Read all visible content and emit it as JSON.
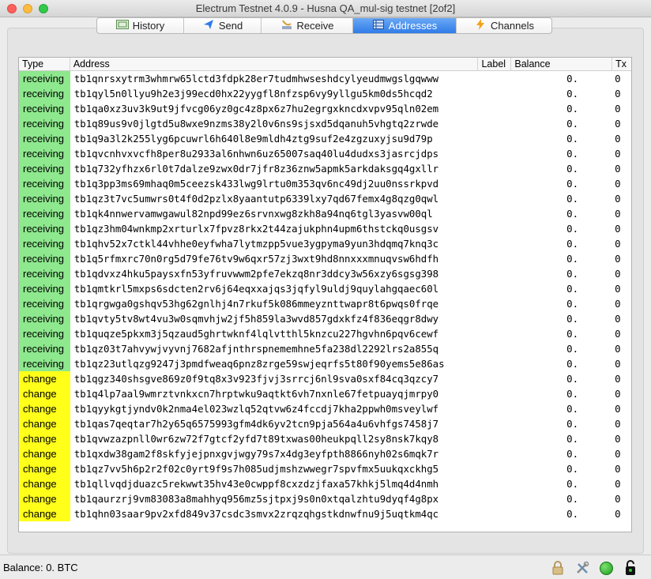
{
  "window": {
    "title": "Electrum Testnet 4.0.9  -  Husna QA_mul-sig testnet  [2of2]"
  },
  "tabs": [
    {
      "label": "History",
      "icon": "history-icon",
      "active": false
    },
    {
      "label": "Send",
      "icon": "send-icon",
      "active": false
    },
    {
      "label": "Receive",
      "icon": "receive-icon",
      "active": false
    },
    {
      "label": "Addresses",
      "icon": "addresses-icon",
      "active": true
    },
    {
      "label": "Channels",
      "icon": "lightning-icon",
      "active": false
    }
  ],
  "table": {
    "headers": {
      "type": "Type",
      "address": "Address",
      "label": "Label",
      "balance": "Balance",
      "tx": "Tx"
    },
    "rows": [
      {
        "type": "receiving",
        "address": "tb1qnrsxytrm3whmrw65lctd3fdpk28er7tudmhwseshdcylyeudmwgslgqwww",
        "label": "",
        "balance": "0.",
        "tx": "0"
      },
      {
        "type": "receiving",
        "address": "tb1qyl5n0llyu9h2e3j99ecd0hx22yygfl8nfzsp6vy9yllgu5km0ds5hcqd2",
        "label": "",
        "balance": "0.",
        "tx": "0"
      },
      {
        "type": "receiving",
        "address": "tb1qa0xz3uv3k9ut9jfvcg06yz0gc4z8px6z7hu2egrgxkncdxvpv95qln02em",
        "label": "",
        "balance": "0.",
        "tx": "0"
      },
      {
        "type": "receiving",
        "address": "tb1q89us9v0jlgtd5u8wxe9nzms38y2l0v6ns9sjsxd5dqanuh5vhgtq2zrwde",
        "label": "",
        "balance": "0.",
        "tx": "0"
      },
      {
        "type": "receiving",
        "address": "tb1q9a3l2k255lyg6pcuwrl6h640l8e9mldh4ztg9suf2e4zgzuxyjsu9d79p",
        "label": "",
        "balance": "0.",
        "tx": "0"
      },
      {
        "type": "receiving",
        "address": "tb1qvcnhvxvcfh8per8u2933al6nhwn6uz65007saq40lu4dudxs3jasrcjdps",
        "label": "",
        "balance": "0.",
        "tx": "0"
      },
      {
        "type": "receiving",
        "address": "tb1q732yfhzx6rl0t7dalze9zwx0dr7jfr8z36znw5apmk5arkdaksgq4gxllr",
        "label": "",
        "balance": "0.",
        "tx": "0"
      },
      {
        "type": "receiving",
        "address": "tb1q3pp3ms69mhaq0m5ceezsk433lwg9lrtu0m353qv6nc49dj2uu0nssrkpvd",
        "label": "",
        "balance": "0.",
        "tx": "0"
      },
      {
        "type": "receiving",
        "address": "tb1qz3t7vc5umwrs0t4f0d2pzlx8yaantutp6339lxy7qd67femx4g8qzg0qwl",
        "label": "",
        "balance": "0.",
        "tx": "0"
      },
      {
        "type": "receiving",
        "address": "tb1qk4nnwervamwgawul82npd99ez6srvnxwg8zkh8a94nq6tgl3yasvw00ql",
        "label": "",
        "balance": "0.",
        "tx": "0"
      },
      {
        "type": "receiving",
        "address": "tb1qz3hm04wnkmp2xrturlx7fpvz8rkx2t44zajukphn4upm6thstckq0usgsv",
        "label": "",
        "balance": "0.",
        "tx": "0"
      },
      {
        "type": "receiving",
        "address": "tb1qhv52x7ctkl44vhhe0eyfwha7lytmzpp5vue3ygpyma9yun3hdqmq7knq3c",
        "label": "",
        "balance": "0.",
        "tx": "0"
      },
      {
        "type": "receiving",
        "address": "tb1q5rfmxrc70n0rg5d79fe76tv9w6qxr57zj3wxt9hd8nnxxxmnuqvsw6hdfh",
        "label": "",
        "balance": "0.",
        "tx": "0"
      },
      {
        "type": "receiving",
        "address": "tb1qdvxz4hku5paysxfn53yfruvwwm2pfe7ekzq8nr3ddcy3w56xzy6sgsg398",
        "label": "",
        "balance": "0.",
        "tx": "0"
      },
      {
        "type": "receiving",
        "address": "tb1qmtkrl5mxps6sdcten2rv6j64eqxxajqs3jqfyl9uldj9quylahgqaec60l",
        "label": "",
        "balance": "0.",
        "tx": "0"
      },
      {
        "type": "receiving",
        "address": "tb1qrgwga0gshqv53hg62gnlhj4n7rkuf5k086mmeyznttwapr8t6pwqs0frqe",
        "label": "",
        "balance": "0.",
        "tx": "0"
      },
      {
        "type": "receiving",
        "address": "tb1qvty5tv8wt4vu3w0sqmvhjw2jf5h859la3wvd857gdxkfz4f836eqgr8dwy",
        "label": "",
        "balance": "0.",
        "tx": "0"
      },
      {
        "type": "receiving",
        "address": "tb1quqze5pkxm3j5qzaud5ghrtwknf4lqlvtthl5knzcu227hgvhn6pqv6cewf",
        "label": "",
        "balance": "0.",
        "tx": "0"
      },
      {
        "type": "receiving",
        "address": "tb1qz03t7ahvywjvyvnj7682afjnthrspnememhne5fa238dl2292lrs2a855q",
        "label": "",
        "balance": "0.",
        "tx": "0"
      },
      {
        "type": "receiving",
        "address": "tb1qz23utlqzg9247j3pmdfweaq6pnz8zrge59swjeqrfs5t80f90yems5e86as",
        "label": "",
        "balance": "0.",
        "tx": "0"
      },
      {
        "type": "change",
        "address": "tb1qgz340shsgve869z0f9tq8x3v923fjvj3srrcj6nl9sva0sxf84cq3qzcy7",
        "label": "",
        "balance": "0.",
        "tx": "0"
      },
      {
        "type": "change",
        "address": "tb1q4lp7aal9wmrztvnkxcn7hrptwku9aqtkt6vh7nxnle67fetpuayqjmrpy0",
        "label": "",
        "balance": "0.",
        "tx": "0"
      },
      {
        "type": "change",
        "address": "tb1qyykgtjyndv0k2nma4el023wzlq52qtvw6z4fccdj7kha2ppwh0msveylwf",
        "label": "",
        "balance": "0.",
        "tx": "0"
      },
      {
        "type": "change",
        "address": "tb1qas7qeqtar7h2y65q6575993gfm4dk6yv2tcn9pja564a4u6vhfgs7458j7",
        "label": "",
        "balance": "0.",
        "tx": "0"
      },
      {
        "type": "change",
        "address": "tb1qvwzazpnll0wr6zw72f7gtcf2yfd7t89txwas00heukpqll2sy8nsk7kqy8",
        "label": "",
        "balance": "0.",
        "tx": "0"
      },
      {
        "type": "change",
        "address": "tb1qxdw38gam2f8skfyjejpnxgvjwgy79s7x4dg3eyfpth8866nyh02s6mqk7r",
        "label": "",
        "balance": "0.",
        "tx": "0"
      },
      {
        "type": "change",
        "address": "tb1qz7vv5h6p2r2f02c0yrt9f9s7h085udjmshzwwegr7spvfmx5uukqxckhg5",
        "label": "",
        "balance": "0.",
        "tx": "0"
      },
      {
        "type": "change",
        "address": "tb1qllvqdjduazc5rekwwt35hv43e0cwppf8cxzdzjfaxa57khkj5lmq4d4nmh",
        "label": "",
        "balance": "0.",
        "tx": "0"
      },
      {
        "type": "change",
        "address": "tb1qaurzrj9vm83083a8mahhyq956mz5sjtpxj9s0n0xtqalzhtu9dyqf4g8px",
        "label": "",
        "balance": "0.",
        "tx": "0"
      },
      {
        "type": "change",
        "address": "tb1qhn03saar9pv2xfd849v37csdc3smvx2zrqzqhgstkdnwfnu9j5uqtkm4qc",
        "label": "",
        "balance": "0.",
        "tx": "0"
      }
    ]
  },
  "statusbar": {
    "balance": "Balance: 0. BTC",
    "icons": [
      "lock-icon",
      "tools-icon",
      "network-status-icon",
      "seed-icon"
    ],
    "network_color": "#2cb52c"
  },
  "colors": {
    "receiving": "#8ee88e",
    "change": "#ffff1a",
    "accent": "#2f7ce8"
  }
}
